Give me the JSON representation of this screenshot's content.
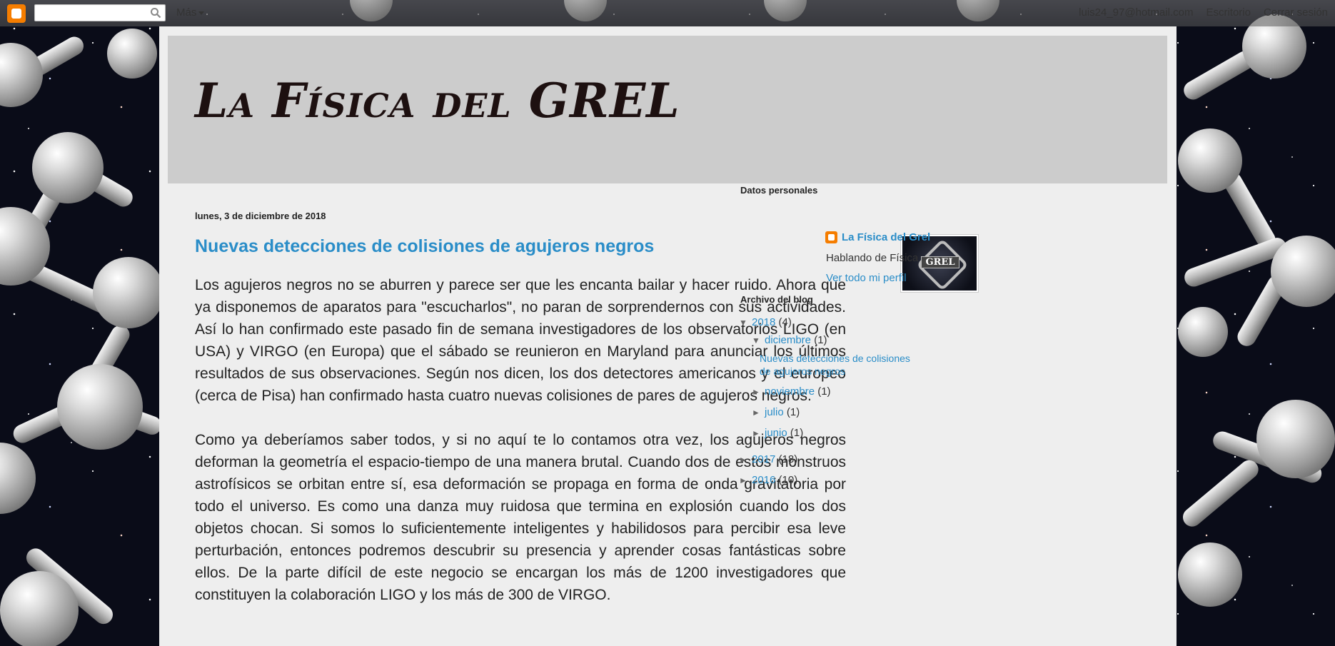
{
  "navbar": {
    "search_placeholder": "",
    "more_label": "Más",
    "email": "luis24_97@hotmail.com",
    "desktop_label": "Escritorio",
    "signout_label": "Cerrar sesión"
  },
  "blog": {
    "title": "La Física del GREL"
  },
  "post": {
    "date": "lunes, 3 de diciembre de 2018",
    "title": "Nuevas detecciones de colisiones de agujeros negros",
    "paragraphs": [
      "Los agujeros negros no se aburren y parece ser que les encanta bailar y hacer ruido. Ahora que ya disponemos de aparatos para \"escucharlos\", no paran de sorprendernos con sus actividades. Así lo han confirmado este pasado fin de semana investigadores de los observatorios LIGO (en USA) y VIRGO (en Europa) que el sábado se reunieron en Maryland para anunciar los últimos resultados de sus observaciones. Según nos dicen, los dos detectores americanos y el europeo (cerca de Pisa) han confirmado hasta cuatro nuevas colisiones de pares de agujeros negros.",
      "Como ya deberíamos saber todos, y si no aquí te lo contamos otra vez, los agujeros negros deforman la geometría el espacio-tiempo de una manera brutal. Cuando dos de estos monstruos astrofísicos se orbitan entre sí, esa deformación se propaga en forma de onda gravitatoria por todo el universo. Es como una danza muy ruidosa que termina en explosión cuando los dos objetos chocan. Si somos lo suficientemente inteligentes y habilidosos para percibir esa leve perturbación, entonces podremos descubrir su presencia y aprender cosas fantásticas sobre ellos. De la parte difícil de este negocio se encargan los más de 1200 investigadores que constituyen la colaboración LIGO y los más de 300 de VIRGO."
    ]
  },
  "sidebar": {
    "profile_heading": "Datos personales",
    "profile_image_text": "GREL",
    "profile_name": "La Física del Grel",
    "profile_desc": "Hablando de Física",
    "profile_link": "Ver todo mi perfil",
    "archive_heading": "Archivo del blog",
    "archive": {
      "y2018": {
        "label": "2018",
        "count": "(4)",
        "expanded": true
      },
      "dic": {
        "label": "diciembre",
        "count": "(1)",
        "expanded": true
      },
      "dic_post": "Nuevas detecciones de colisiones de agujeros negros",
      "nov": {
        "label": "noviembre",
        "count": "(1)"
      },
      "jul": {
        "label": "julio",
        "count": "(1)"
      },
      "jun": {
        "label": "junio",
        "count": "(1)"
      },
      "y2017": {
        "label": "2017",
        "count": "(18)"
      },
      "y2016": {
        "label": "2016",
        "count": "(10)"
      }
    }
  },
  "colors": {
    "link": "#2a8dc8",
    "header_bg": "#cccccc",
    "content_bg": "#eeeeee",
    "blogger_orange": "#f57d00"
  }
}
